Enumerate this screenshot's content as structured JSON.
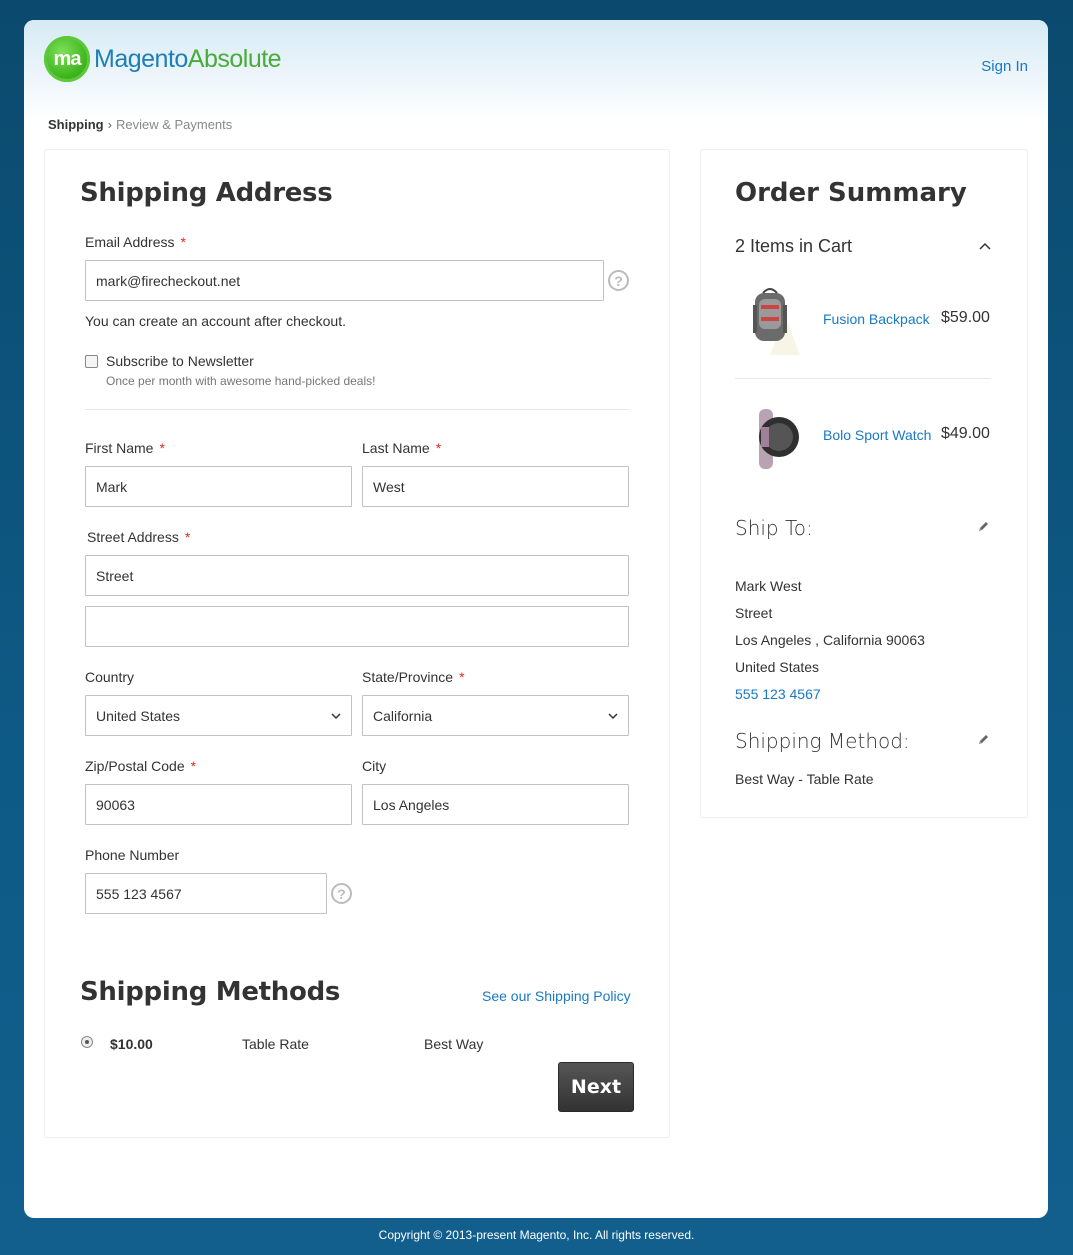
{
  "header": {
    "logo_badge": "ma",
    "logo_text_1": "Magento",
    "logo_text_2": "Absolute",
    "sign_in": "Sign In"
  },
  "breadcrumb": {
    "step1": "Shipping",
    "separator": "›",
    "step2": "Review & Payments"
  },
  "shipping_address": {
    "title": "Shipping Address",
    "email_label": "Email Address",
    "email_value": "mark@firecheckout.net",
    "account_note": "You can create an account after checkout.",
    "newsletter_label": "Subscribe to Newsletter",
    "newsletter_note": "Once per month with awesome hand-picked deals!",
    "first_name_label": "First Name",
    "first_name_value": "Mark",
    "last_name_label": "Last Name",
    "last_name_value": "West",
    "street_label": "Street Address",
    "street_value_1": "Street",
    "street_value_2": "",
    "country_label": "Country",
    "country_value": "United States",
    "state_label": "State/Province",
    "state_value": "California",
    "zip_label": "Zip/Postal Code",
    "zip_value": "90063",
    "city_label": "City",
    "city_value": "Los Angeles",
    "phone_label": "Phone Number",
    "phone_value": "555 123 4567",
    "required_mark": "*",
    "help_glyph": "?"
  },
  "shipping_methods": {
    "title": "Shipping Methods",
    "policy_link": "See our Shipping Policy",
    "method": {
      "price": "$10.00",
      "method_title": "Table Rate",
      "carrier_title": "Best Way"
    },
    "next_button": "Next"
  },
  "order_summary": {
    "title": "Order Summary",
    "items_count": "2 Items in Cart",
    "items": [
      {
        "name": "Fusion Backpack",
        "price": "$59.00"
      },
      {
        "name": "Bolo Sport Watch",
        "price": "$49.00"
      }
    ],
    "ship_to": {
      "heading": "Ship To:",
      "name": "Mark West",
      "street": "Street",
      "city_line": "Los Angeles , California 90063",
      "country": "United States",
      "phone": "555 123 4567"
    },
    "shipping_method": {
      "heading": "Shipping Method:",
      "value": "Best Way - Table Rate"
    }
  },
  "footer": {
    "copyright": "Copyright © 2013-present Magento, Inc. All rights reserved."
  },
  "colors": {
    "accent_link": "#1979c3",
    "required": "#e02b27",
    "background": "#0e5a86",
    "logo_green": "#3fb51f"
  }
}
